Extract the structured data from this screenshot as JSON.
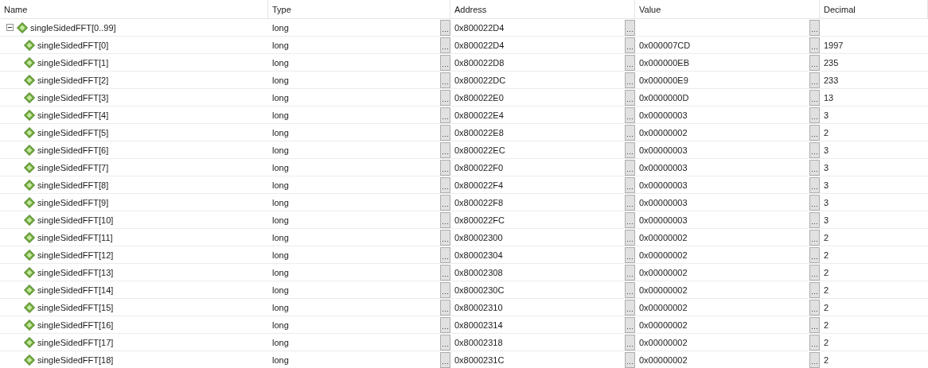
{
  "columns": [
    "Name",
    "Type",
    "Address",
    "Value",
    "Decimal"
  ],
  "root": {
    "name": "singleSidedFFT[0..99]",
    "type": "long",
    "address": "0x800022D4",
    "expanded": true,
    "children": [
      {
        "name": "singleSidedFFT[0]",
        "type": "long",
        "address": "0x800022D4",
        "value": "0x000007CD",
        "decimal": "1997"
      },
      {
        "name": "singleSidedFFT[1]",
        "type": "long",
        "address": "0x800022D8",
        "value": "0x000000EB",
        "decimal": "235"
      },
      {
        "name": "singleSidedFFT[2]",
        "type": "long",
        "address": "0x800022DC",
        "value": "0x000000E9",
        "decimal": "233"
      },
      {
        "name": "singleSidedFFT[3]",
        "type": "long",
        "address": "0x800022E0",
        "value": "0x0000000D",
        "decimal": "13"
      },
      {
        "name": "singleSidedFFT[4]",
        "type": "long",
        "address": "0x800022E4",
        "value": "0x00000003",
        "decimal": "3"
      },
      {
        "name": "singleSidedFFT[5]",
        "type": "long",
        "address": "0x800022E8",
        "value": "0x00000002",
        "decimal": "2"
      },
      {
        "name": "singleSidedFFT[6]",
        "type": "long",
        "address": "0x800022EC",
        "value": "0x00000003",
        "decimal": "3"
      },
      {
        "name": "singleSidedFFT[7]",
        "type": "long",
        "address": "0x800022F0",
        "value": "0x00000003",
        "decimal": "3"
      },
      {
        "name": "singleSidedFFT[8]",
        "type": "long",
        "address": "0x800022F4",
        "value": "0x00000003",
        "decimal": "3"
      },
      {
        "name": "singleSidedFFT[9]",
        "type": "long",
        "address": "0x800022F8",
        "value": "0x00000003",
        "decimal": "3"
      },
      {
        "name": "singleSidedFFT[10]",
        "type": "long",
        "address": "0x800022FC",
        "value": "0x00000003",
        "decimal": "3"
      },
      {
        "name": "singleSidedFFT[11]",
        "type": "long",
        "address": "0x80002300",
        "value": "0x00000002",
        "decimal": "2"
      },
      {
        "name": "singleSidedFFT[12]",
        "type": "long",
        "address": "0x80002304",
        "value": "0x00000002",
        "decimal": "2"
      },
      {
        "name": "singleSidedFFT[13]",
        "type": "long",
        "address": "0x80002308",
        "value": "0x00000002",
        "decimal": "2"
      },
      {
        "name": "singleSidedFFT[14]",
        "type": "long",
        "address": "0x8000230C",
        "value": "0x00000002",
        "decimal": "2"
      },
      {
        "name": "singleSidedFFT[15]",
        "type": "long",
        "address": "0x80002310",
        "value": "0x00000002",
        "decimal": "2"
      },
      {
        "name": "singleSidedFFT[16]",
        "type": "long",
        "address": "0x80002314",
        "value": "0x00000002",
        "decimal": "2"
      },
      {
        "name": "singleSidedFFT[17]",
        "type": "long",
        "address": "0x80002318",
        "value": "0x00000002",
        "decimal": "2"
      },
      {
        "name": "singleSidedFFT[18]",
        "type": "long",
        "address": "0x8000231C",
        "value": "0x00000002",
        "decimal": "2"
      }
    ]
  }
}
